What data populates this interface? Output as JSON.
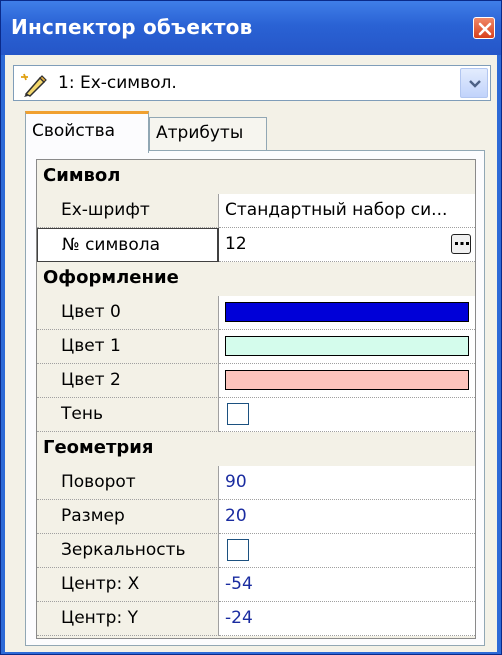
{
  "window": {
    "title": "Инспектор объектов",
    "icons": {
      "close": "close-icon"
    }
  },
  "object_select": {
    "icon": "pencil-wand-icon",
    "value": "1: Ex-символ."
  },
  "tabs": [
    {
      "label": "Свойства",
      "active": true
    },
    {
      "label": "Атрибуты",
      "active": false
    }
  ],
  "grid": {
    "categories": {
      "symbol": "Символ",
      "design": "Оформление",
      "geometry": "Геометрия"
    },
    "props": {
      "ex_font": {
        "name": "Ex-шрифт",
        "value": "Стандартный набор си..."
      },
      "symbol_no": {
        "name": "№ символа",
        "value": "12"
      },
      "color0": {
        "name": "Цвет 0",
        "color": "#0000d8"
      },
      "color1": {
        "name": "Цвет 1",
        "color": "#d4fcec"
      },
      "color2": {
        "name": "Цвет 2",
        "color": "#fcc4bc"
      },
      "shadow": {
        "name": "Тень",
        "checked": false
      },
      "rotation": {
        "name": "Поворот",
        "value": "90"
      },
      "size": {
        "name": "Размер",
        "value": "20"
      },
      "mirror": {
        "name": "Зеркальность",
        "checked": false
      },
      "center_x": {
        "name": "Центр: X",
        "value": "-54"
      },
      "center_y": {
        "name": "Центр: Y",
        "value": "-24"
      }
    }
  },
  "colors": {
    "titlebar": "#2a62d4",
    "client_bg": "#f3f1e7",
    "active_tab_accent": "#f0a030",
    "numeric_value": "#1a2ca0"
  }
}
